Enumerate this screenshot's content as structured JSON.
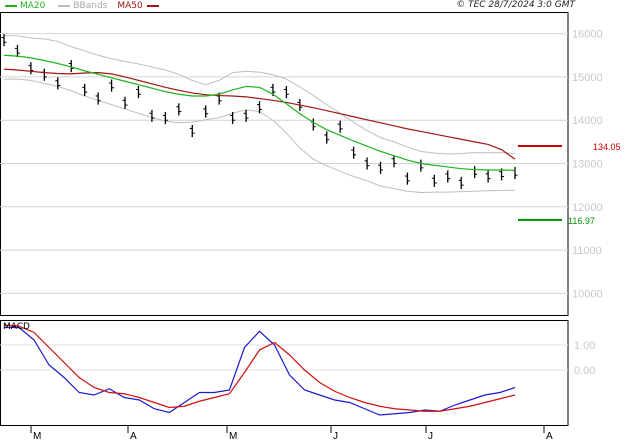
{
  "legend": {
    "items": [
      {
        "label": "MA20",
        "color": "#1db31d"
      },
      {
        "label": "BBands",
        "color": "#b0b0b0"
      },
      {
        "label": "MA50",
        "color": "#a01515"
      }
    ]
  },
  "copyright": "© TEC 28/7/2024 3:0 GMT",
  "macd_label": "MACD",
  "chart_data": [
    {
      "type": "line",
      "title": "",
      "x_labels": [
        "M",
        "A",
        "M",
        "J",
        "J",
        "A"
      ],
      "y_ticks": [
        "16000",
        "15000",
        "14000",
        "13000",
        "12000",
        "11000",
        "10000"
      ],
      "ylim": [
        9500,
        16500
      ],
      "grid": true,
      "levels": [
        {
          "label": "134.05",
          "value": 13405,
          "color": "#d00000"
        },
        {
          "label": "116.97",
          "value": 11697,
          "color": "#009000"
        }
      ],
      "series": [
        {
          "name": "MA20",
          "color": "#1db31d",
          "values": [
            15500,
            15480,
            15440,
            15380,
            15310,
            15230,
            15140,
            15060,
            14980,
            14900,
            14820,
            14740,
            14660,
            14600,
            14560,
            14560,
            14600,
            14700,
            14780,
            14760,
            14600,
            14380,
            14150,
            13950,
            13780,
            13650,
            13520,
            13400,
            13280,
            13180,
            13080,
            13000,
            12960,
            12920,
            12880,
            12860,
            12850,
            12850,
            12840
          ]
        },
        {
          "name": "MA50",
          "color": "#a01515",
          "values": [
            15180,
            15160,
            15130,
            15100,
            15080,
            15070,
            15090,
            15100,
            15070,
            15000,
            14920,
            14840,
            14760,
            14690,
            14630,
            14590,
            14570,
            14560,
            14540,
            14500,
            14460,
            14410,
            14350,
            14290,
            14220,
            14150,
            14080,
            14010,
            13940,
            13870,
            13800,
            13740,
            13680,
            13620,
            13560,
            13500,
            13440,
            13320,
            13100
          ]
        },
        {
          "name": "BBands",
          "color": "#bebebe",
          "values": [
            15950,
            15950,
            15900,
            15880,
            15820,
            15700,
            15600,
            15500,
            15420,
            15360,
            15300,
            15230,
            15160,
            15060,
            14920,
            14820,
            14920,
            15100,
            15130,
            15110,
            15050,
            14950,
            14770,
            14570,
            14360,
            14160,
            13950,
            13760,
            13600,
            13500,
            13380,
            13280,
            13240,
            13220,
            13230,
            13250,
            13250,
            13250,
            13230
          ]
        },
        {
          "name": "BBands lower",
          "color": "#bebebe",
          "values": [
            14950,
            14950,
            14920,
            14850,
            14780,
            14680,
            14560,
            14460,
            14360,
            14260,
            14160,
            14060,
            13980,
            13940,
            13960,
            14010,
            14060,
            14160,
            14240,
            14200,
            14000,
            13700,
            13360,
            13100,
            12950,
            12820,
            12700,
            12600,
            12480,
            12420,
            12360,
            12330,
            12340,
            12340,
            12350,
            12360,
            12370,
            12380,
            12380
          ]
        },
        {
          "name": "Price",
          "color": "#000000",
          "values": [
            15850,
            15600,
            15200,
            15050,
            14850,
            15250,
            14700,
            14500,
            14800,
            14400,
            14650,
            14100,
            14050,
            14250,
            13750,
            14200,
            14500,
            14050,
            14100,
            14300,
            14700,
            14650,
            14350,
            13900,
            13600,
            13850,
            13250,
            13000,
            12900,
            13050,
            12650,
            12950,
            12600,
            12700,
            12550,
            12800,
            12700,
            12750,
            12780
          ]
        }
      ]
    },
    {
      "type": "line",
      "title": "",
      "y_ticks": [
        "0.00",
        "1.00"
      ],
      "ylim": [
        -2.2,
        2.0
      ],
      "series": [
        {
          "name": "MACD",
          "color": "#1a1ad0",
          "values": [
            1.7,
            1.7,
            1.2,
            0.2,
            -0.3,
            -0.9,
            -1.0,
            -0.75,
            -1.1,
            -1.2,
            -1.55,
            -1.7,
            -1.3,
            -0.9,
            -0.9,
            -0.8,
            0.9,
            1.55,
            1.0,
            -0.2,
            -0.8,
            -1.0,
            -1.2,
            -1.3,
            -1.55,
            -1.8,
            -1.75,
            -1.7,
            -1.6,
            -1.65,
            -1.4,
            -1.2,
            -1.0,
            -0.9,
            -0.7
          ]
        },
        {
          "name": "Signal",
          "color": "#d01010",
          "values": [
            1.8,
            1.75,
            1.5,
            0.9,
            0.3,
            -0.3,
            -0.7,
            -0.9,
            -0.95,
            -1.1,
            -1.3,
            -1.5,
            -1.45,
            -1.25,
            -1.1,
            -0.95,
            -0.1,
            0.8,
            1.1,
            0.6,
            0.0,
            -0.5,
            -0.85,
            -1.1,
            -1.3,
            -1.45,
            -1.55,
            -1.6,
            -1.65,
            -1.65,
            -1.55,
            -1.45,
            -1.3,
            -1.15,
            -1.0
          ]
        }
      ]
    }
  ]
}
